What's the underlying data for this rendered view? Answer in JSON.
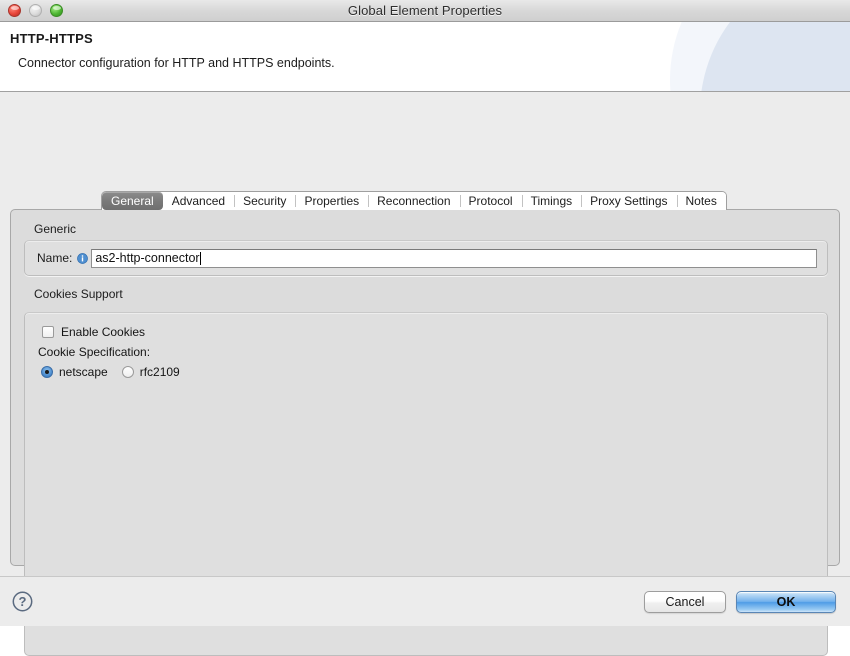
{
  "window": {
    "title": "Global Element Properties",
    "controls": {
      "close": "close-button",
      "minimize": "minimize-button",
      "zoom": "zoom-button"
    }
  },
  "header": {
    "title": "HTTP-HTTPS",
    "description": "Connector configuration for HTTP and HTTPS endpoints."
  },
  "tabs": [
    {
      "label": "General",
      "selected": true
    },
    {
      "label": "Advanced",
      "selected": false
    },
    {
      "label": "Security",
      "selected": false
    },
    {
      "label": "Properties",
      "selected": false
    },
    {
      "label": "Reconnection",
      "selected": false
    },
    {
      "label": "Protocol",
      "selected": false
    },
    {
      "label": "Timings",
      "selected": false
    },
    {
      "label": "Proxy Settings",
      "selected": false
    },
    {
      "label": "Notes",
      "selected": false
    }
  ],
  "general_tab": {
    "generic": {
      "group_label": "Generic",
      "name_label": "Name:",
      "name_value": "as2-http-connector",
      "name_placeholder": "",
      "info_icon": "info-icon"
    },
    "cookies": {
      "group_label": "Cookies Support",
      "enable_cookies_label": "Enable Cookies",
      "enable_cookies_checked": false,
      "spec_label": "Cookie Specification:",
      "spec_options": [
        {
          "label": "netscape",
          "selected": true
        },
        {
          "label": "rfc2109",
          "selected": false
        }
      ]
    }
  },
  "footer": {
    "help_icon": "help-icon",
    "cancel_label": "Cancel",
    "ok_label": "OK"
  },
  "colors": {
    "accent_blue": "#4e9ce6",
    "panel_bg": "#dcdcdc",
    "window_bg": "#ececec",
    "selected_tab": "#7a7a7a",
    "close_red": "#e8463a",
    "zoom_green": "#4fb733"
  }
}
